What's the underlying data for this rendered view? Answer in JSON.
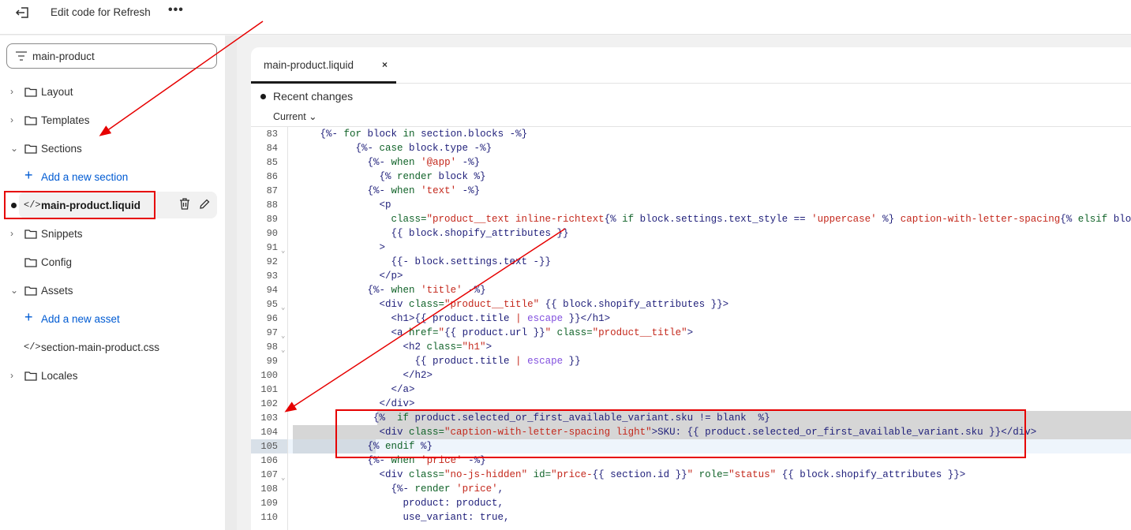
{
  "topbar": {
    "title": "Edit code for Refresh",
    "more_label": "•••"
  },
  "sidebar": {
    "search_value": "main-product",
    "items": [
      {
        "type": "folder",
        "label": "Layout",
        "expanded": false
      },
      {
        "type": "folder",
        "label": "Templates",
        "expanded": false
      },
      {
        "type": "folder",
        "label": "Sections",
        "expanded": true
      },
      {
        "type": "add",
        "label": "Add a new section"
      },
      {
        "type": "file",
        "label": "main-product.liquid",
        "selected": true
      },
      {
        "type": "folder",
        "label": "Snippets",
        "expanded": false
      },
      {
        "type": "folder",
        "label": "Config",
        "expanded": null
      },
      {
        "type": "folder",
        "label": "Assets",
        "expanded": true
      },
      {
        "type": "add",
        "label": "Add a new asset"
      },
      {
        "type": "file",
        "label": "section-main-product.css"
      },
      {
        "type": "folder",
        "label": "Locales",
        "expanded": false
      }
    ]
  },
  "editor": {
    "tab_label": "main-product.liquid",
    "tab_close": "×",
    "recent_changes": "Recent changes",
    "version_select": "Current",
    "lines": [
      {
        "n": "83",
        "t": [
          [
            "p",
            "     {%- "
          ],
          [
            "k",
            "for"
          ],
          [
            "p",
            " block "
          ],
          [
            "k",
            "in"
          ],
          [
            "p",
            " section.blocks -%}"
          ]
        ]
      },
      {
        "n": "84",
        "t": [
          [
            "p",
            "           {%- "
          ],
          [
            "k",
            "case"
          ],
          [
            "p",
            " block.type -%}"
          ]
        ]
      },
      {
        "n": "85",
        "t": [
          [
            "p",
            "             {%- "
          ],
          [
            "k",
            "when"
          ],
          [
            "p",
            " "
          ],
          [
            "s",
            "'@app'"
          ],
          [
            "p",
            " -%}"
          ]
        ]
      },
      {
        "n": "86",
        "t": [
          [
            "p",
            "               {% "
          ],
          [
            "k",
            "render"
          ],
          [
            "p",
            " block %}"
          ]
        ]
      },
      {
        "n": "87",
        "t": [
          [
            "p",
            "             {%- "
          ],
          [
            "k",
            "when"
          ],
          [
            "p",
            " "
          ],
          [
            "s",
            "'text'"
          ],
          [
            "p",
            " -%}"
          ]
        ]
      },
      {
        "n": "88",
        "t": [
          [
            "t",
            "               <p"
          ]
        ]
      },
      {
        "n": "89",
        "t": [
          [
            "a",
            "                 class="
          ],
          [
            "s",
            "\"product__text inline-richtext"
          ],
          [
            "p",
            "{% "
          ],
          [
            "k",
            "if"
          ],
          [
            "p",
            " block.settings.text_style == "
          ],
          [
            "s",
            "'uppercase'"
          ],
          [
            "p",
            " %}"
          ],
          [
            "s",
            " caption-with-letter-spacing"
          ],
          [
            "p",
            "{% "
          ],
          [
            "k",
            "elsif"
          ],
          [
            "p",
            " block.settings"
          ]
        ]
      },
      {
        "n": "90",
        "t": [
          [
            "p",
            "                 {{ block.shopify_attributes }}"
          ]
        ]
      },
      {
        "n": "91",
        "fold": true,
        "t": [
          [
            "t",
            "               >"
          ]
        ]
      },
      {
        "n": "92",
        "t": [
          [
            "p",
            "                 {{- block.settings.text -}}"
          ]
        ]
      },
      {
        "n": "93",
        "t": [
          [
            "t",
            "               </p>"
          ]
        ]
      },
      {
        "n": "94",
        "t": [
          [
            "p",
            "             {%- "
          ],
          [
            "k",
            "when"
          ],
          [
            "p",
            " "
          ],
          [
            "s",
            "'title'"
          ],
          [
            "p",
            " -%}"
          ]
        ]
      },
      {
        "n": "95",
        "fold": true,
        "t": [
          [
            "t",
            "               <div "
          ],
          [
            "a",
            "class="
          ],
          [
            "s",
            "\"product__title\""
          ],
          [
            "p",
            " {{ block.shopify_attributes }}>"
          ]
        ]
      },
      {
        "n": "96",
        "t": [
          [
            "t",
            "                 <h1>"
          ],
          [
            "p",
            "{{ product.title "
          ],
          [
            "s",
            "| "
          ],
          [
            "f",
            "escape"
          ],
          [
            "p",
            " }}"
          ],
          [
            "t",
            "</h1>"
          ]
        ]
      },
      {
        "n": "97",
        "fold": true,
        "t": [
          [
            "t",
            "                 <a "
          ],
          [
            "a",
            "href="
          ],
          [
            "s",
            "\""
          ],
          [
            "p",
            "{{ product.url }}"
          ],
          [
            "s",
            "\""
          ],
          [
            "a",
            " class="
          ],
          [
            "s",
            "\"product__title\""
          ],
          [
            "t",
            ">"
          ]
        ]
      },
      {
        "n": "98",
        "fold": true,
        "t": [
          [
            "t",
            "                   <h2 "
          ],
          [
            "a",
            "class="
          ],
          [
            "s",
            "\"h1\""
          ],
          [
            "t",
            ">"
          ]
        ]
      },
      {
        "n": "99",
        "t": [
          [
            "p",
            "                     {{ product.title "
          ],
          [
            "s",
            "| "
          ],
          [
            "f",
            "escape"
          ],
          [
            "p",
            " }}"
          ]
        ]
      },
      {
        "n": "100",
        "t": [
          [
            "t",
            "                   </h2>"
          ]
        ]
      },
      {
        "n": "101",
        "t": [
          [
            "t",
            "                 </a>"
          ]
        ]
      },
      {
        "n": "102",
        "t": [
          [
            "t",
            "               </div>"
          ]
        ]
      },
      {
        "n": "103",
        "hl": "gray-partial",
        "t": [
          [
            "p",
            "              {%  "
          ],
          [
            "k",
            "if"
          ],
          [
            "p",
            " product.selected_or_first_available_variant.sku != blank  %}"
          ]
        ]
      },
      {
        "n": "104",
        "hl": "gray",
        "t": [
          [
            "t",
            "               <div "
          ],
          [
            "a",
            "class="
          ],
          [
            "s",
            "\"caption-with-letter-spacing light\""
          ],
          [
            "t",
            ">SKU: "
          ],
          [
            "p",
            "{{ product.selected_or_first_available_variant.sku }}"
          ],
          [
            "t",
            "</div>"
          ]
        ]
      },
      {
        "n": "105",
        "hl": "active",
        "t": [
          [
            "p",
            "             {% "
          ],
          [
            "k",
            "endif"
          ],
          [
            "p",
            " %}"
          ]
        ]
      },
      {
        "n": "106",
        "t": [
          [
            "p",
            "             {%- "
          ],
          [
            "k",
            "when"
          ],
          [
            "p",
            " "
          ],
          [
            "s",
            "'price'"
          ],
          [
            "p",
            " -%}"
          ]
        ]
      },
      {
        "n": "107",
        "fold": true,
        "t": [
          [
            "t",
            "               <div "
          ],
          [
            "a",
            "class="
          ],
          [
            "s",
            "\"no-js-hidden\""
          ],
          [
            "a",
            " id="
          ],
          [
            "s",
            "\"price-"
          ],
          [
            "p",
            "{{ section.id }}"
          ],
          [
            "s",
            "\""
          ],
          [
            "a",
            " role="
          ],
          [
            "s",
            "\"status\""
          ],
          [
            "p",
            " {{ block.shopify_attributes }}>"
          ]
        ]
      },
      {
        "n": "108",
        "t": [
          [
            "p",
            "                 {%- "
          ],
          [
            "k",
            "render"
          ],
          [
            "p",
            " "
          ],
          [
            "s",
            "'price'"
          ],
          [
            "p",
            ","
          ]
        ]
      },
      {
        "n": "109",
        "t": [
          [
            "p",
            "                   product: product,"
          ]
        ]
      },
      {
        "n": "110",
        "t": [
          [
            "p",
            "                   use_variant: true,"
          ]
        ]
      }
    ]
  },
  "colors": {
    "annotation": "#e60000",
    "link": "#005bd3"
  }
}
